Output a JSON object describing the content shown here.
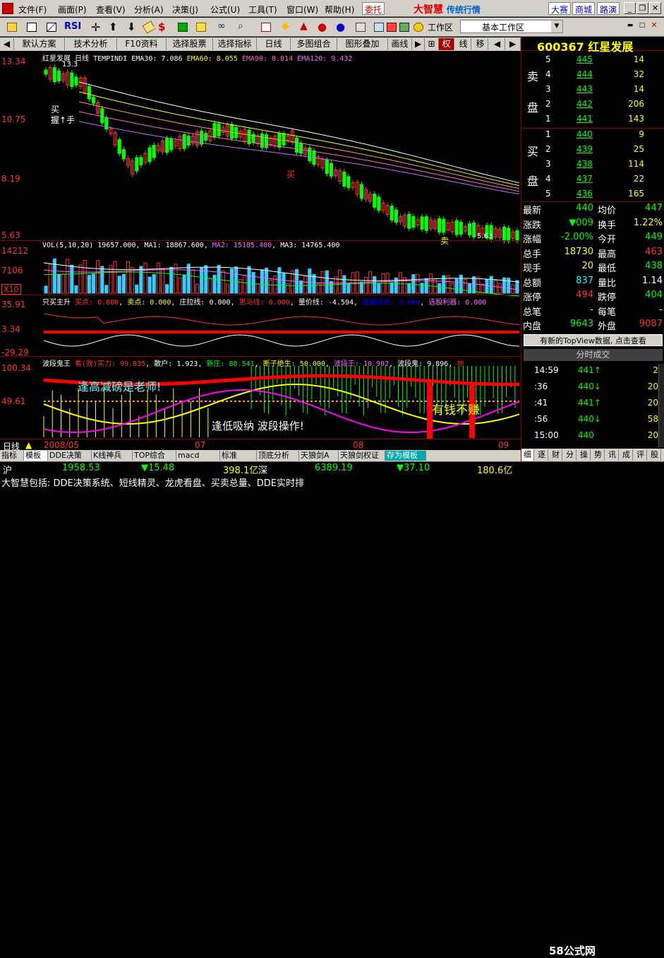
{
  "menubar": {
    "items": [
      "文件(F)",
      "画面(P)",
      "查看(V)",
      "分析(A)",
      "决策(J)",
      "公式(U)",
      "工具(T)",
      "窗口(W)",
      "帮助(H)"
    ],
    "entrust": "委托",
    "brand": "大智慧",
    "brand_sub": "传统行情",
    "links": [
      "大赛",
      "商城",
      "路演"
    ]
  },
  "toolbar": {
    "icons": [
      "open-icon",
      "chart-icon",
      "line-icon",
      "bar-icon",
      "rsi-icon",
      "cross-icon",
      "zoom-in-icon",
      "zoom-out-icon",
      "ruler-icon",
      "dollar-icon",
      "stock-icon",
      "money-icon",
      "binoculars-icon",
      "search-icon",
      "mail-icon",
      "diamond-icon",
      "chart-up-icon",
      "red-icon",
      "blue-icon",
      "calc-icon",
      "grid-icon",
      "ribbon-icon",
      "book-icon",
      "coin-icon"
    ],
    "rsi": "RSI",
    "work_label": "工作区",
    "work_value": "基本工作区"
  },
  "tabs": [
    "默认方案",
    "技术分析",
    "F10资料",
    "选择股票",
    "选择指标",
    "日线",
    "多图组合",
    "图形叠加",
    "画线",
    "权",
    "线",
    "移"
  ],
  "stock": {
    "code": "600367",
    "name": "红星发展"
  },
  "chart_data": [
    {
      "type": "candlestick",
      "title": "红星发展",
      "period": "日线",
      "indicator": "TEMPINDI",
      "ma": [
        {
          "name": "EMA30",
          "value": "7.086",
          "color": "#ffffff"
        },
        {
          "name": "EMA60",
          "value": "8.055",
          "color": "#ffff00"
        },
        {
          "name": "EMA90",
          "value": "8.814",
          "color": "#ff66cc"
        },
        {
          "name": "EMA120",
          "value": "9.432",
          "color": "#ff66ff"
        }
      ],
      "y_ticks": [
        "13.34",
        "10.75",
        "8.19",
        "5.63"
      ],
      "ylim": [
        5.63,
        13.34
      ],
      "annotations": [
        "13.3",
        "5.63",
        "买",
        "握↑手",
        "买",
        "卖"
      ]
    },
    {
      "type": "bar",
      "title": "VOL(5,10,20)",
      "values_text": [
        "19657.000",
        "MA1: 18867.600",
        "MA2: 15185.400",
        "MA3: 14765.400"
      ],
      "y_ticks": [
        "14212",
        "7106",
        "X10"
      ]
    },
    {
      "type": "line",
      "title": "只买主升",
      "labels": [
        "买点: 0.000",
        "卖点: 0.000",
        "庄拉线: 0.000",
        "黑马线: 0.000",
        "量价线: -4.594",
        "涨幅流光: 0.000",
        "选股利器: 0.000"
      ],
      "y_ticks": [
        "35.91",
        "3.34",
        "-29.29"
      ]
    },
    {
      "type": "line",
      "title": "波段鬼王",
      "labels": [
        "看(我)实力: 99.835",
        "散户: 1.923",
        "新庄: 88.541",
        "断子绝生: 50.000",
        "波段王: 10.902",
        "波段鬼: 9.896",
        "地"
      ],
      "y_ticks": [
        "100.34",
        "49.61"
      ],
      "annotations": [
        "逢高减磅是老师!",
        "有钱不赚",
        "逢低吸纳 波段操作!"
      ]
    }
  ],
  "x_axis": {
    "period": "日线",
    "labels": [
      "2008/05",
      "07",
      "08",
      "09"
    ]
  },
  "bottom_tabs": [
    "指标",
    "模板",
    "DDE决策",
    "K线神兵",
    "TOP综合",
    "macd",
    "标准",
    "顶底分析",
    "天狼剑A",
    "天狼剑权证",
    "存为模板"
  ],
  "orderbook": {
    "sell_label": [
      "卖",
      "盘"
    ],
    "buy_label": [
      "买",
      "盘"
    ],
    "sell": [
      {
        "i": "5",
        "p": "445",
        "v": "14"
      },
      {
        "i": "4",
        "p": "444",
        "v": "32"
      },
      {
        "i": "3",
        "p": "443",
        "v": "14"
      },
      {
        "i": "2",
        "p": "442",
        "v": "206"
      },
      {
        "i": "1",
        "p": "441",
        "v": "143"
      }
    ],
    "buy": [
      {
        "i": "1",
        "p": "440",
        "v": "9"
      },
      {
        "i": "2",
        "p": "439",
        "v": "25"
      },
      {
        "i": "3",
        "p": "438",
        "v": "114"
      },
      {
        "i": "4",
        "p": "437",
        "p2": "",
        "v": "22"
      },
      {
        "i": "5",
        "p": "436",
        "v": "165"
      }
    ]
  },
  "quote": [
    {
      "l1": "最新",
      "v1": "440",
      "c1": "#00ff00",
      "l2": "均价",
      "v2": "447",
      "c2": "#00ff00"
    },
    {
      "l1": "涨跌",
      "v1": "▼009",
      "c1": "#00ff00",
      "l2": "换手",
      "v2": "1.22%",
      "c2": "#ffff00"
    },
    {
      "l1": "涨幅",
      "v1": "-2.00%",
      "c1": "#00ff00",
      "l2": "今开",
      "v2": "449",
      "c2": "#00ff00"
    },
    {
      "l1": "总手",
      "v1": "18730",
      "c1": "#ffff00",
      "l2": "最高",
      "v2": "463",
      "c2": "#ff3333"
    },
    {
      "l1": "现手",
      "v1": "20",
      "c1": "#ffff00",
      "l2": "最低",
      "v2": "438",
      "c2": "#00ff00"
    },
    {
      "l1": "总额",
      "v1": "837",
      "c1": "#00ffff",
      "l2": "量比",
      "v2": "1.14",
      "c2": "#ffffff"
    },
    {
      "l1": "涨停",
      "v1": "494",
      "c1": "#ff3333",
      "l2": "跌停",
      "v2": "404",
      "c2": "#00ff00"
    },
    {
      "l1": "总笔",
      "v1": "-",
      "c1": "#ffffff",
      "l2": "每笔",
      "v2": "-",
      "c2": "#ffffff"
    },
    {
      "l1": "内盘",
      "v1": "9643",
      "c1": "#00ff00",
      "l2": "外盘",
      "v2": "9087",
      "c2": "#ff3333"
    }
  ],
  "topview_text": "有新的TopView数据, 点击查看",
  "trades_header": "分时成交",
  "trades": [
    {
      "t": "14:59",
      "p": "441↑",
      "v": "2"
    },
    {
      "t": ":36",
      "p": "440↓",
      "v": "20"
    },
    {
      "t": ":41",
      "p": "441↑",
      "v": "20"
    },
    {
      "t": ":56",
      "p": "440↓",
      "v": "58"
    },
    {
      "t": "15:00",
      "p": "440",
      "v": "20"
    }
  ],
  "right_tabs": [
    "细",
    "逐",
    "财",
    "分",
    "操",
    "势",
    "讯",
    "成",
    "评",
    "股"
  ],
  "index_bar": {
    "sh_label": "沪",
    "sh_value": "1958.53",
    "sh_change": "▼15.48",
    "sh_amount": "398.1亿",
    "sz_label": "深",
    "sz_value": "6389.19",
    "sz_change": "▼37.10",
    "sz_amount": "180.6亿"
  },
  "ticker_text": "大智慧包括: DDE决策系统、短线精灵、龙虎看盘、买卖总量、DDE实时排",
  "watermark": "58公式网"
}
